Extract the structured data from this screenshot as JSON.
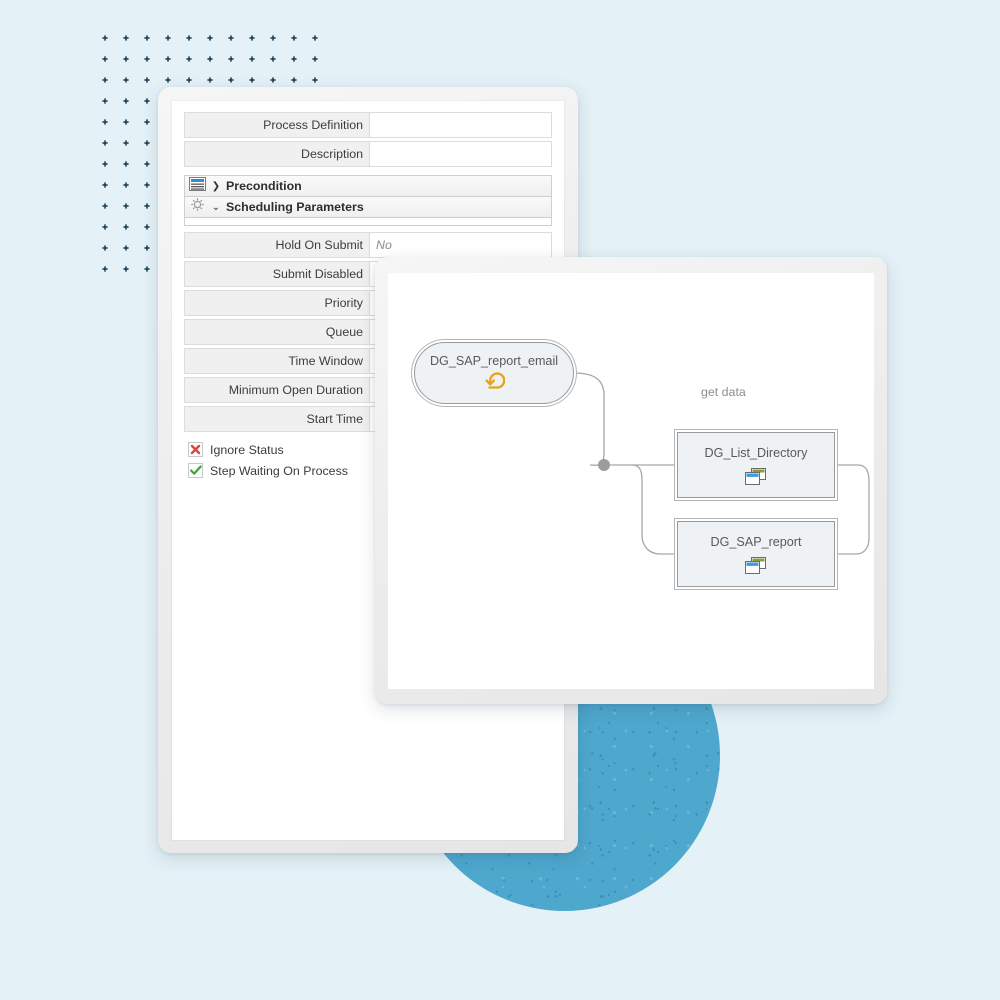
{
  "theme": {
    "background": "#e4f1f7",
    "accent_circle": "#4ea7cd",
    "dot_color": "#143a52",
    "panel_bg": "#ececec",
    "canvas_bg": "#ffffff",
    "label_cell_bg": "#f0f0f0",
    "node_fill": "#eef2f4",
    "node_border": "#9a9a9a",
    "wire_color": "#a6a6a6",
    "start_icon_color": "#e8a317",
    "check_green": "#3aa33a",
    "cross_red": "#d9453a"
  },
  "form_panel": {
    "name": "process-definition-form",
    "rows": [
      {
        "label": "Process Definition",
        "value": "",
        "placeholder": ""
      },
      {
        "label": "Description",
        "value": "",
        "placeholder": ""
      }
    ],
    "sections": [
      {
        "name": "precondition",
        "title": "Precondition",
        "expanded": false,
        "chevron": "❯",
        "icon": "form-list-icon"
      },
      {
        "name": "scheduling-parameters",
        "title": "Scheduling Parameters",
        "expanded": true,
        "chevron": "⌄",
        "icon": "gear-icon"
      }
    ],
    "scheduling_rows": [
      {
        "label": "Hold On Submit",
        "value": "No",
        "is_placeholder": true
      },
      {
        "label": "Submit Disabled",
        "value": "",
        "is_placeholder": false
      },
      {
        "label": "Priority",
        "value": "",
        "is_placeholder": false
      },
      {
        "label": "Queue",
        "value": "",
        "is_placeholder": false
      },
      {
        "label": "Time Window",
        "value": "",
        "is_placeholder": false
      },
      {
        "label": "Minimum Open Duration",
        "value": "",
        "is_placeholder": false
      },
      {
        "label": "Start Time",
        "value": "",
        "is_placeholder": false
      }
    ],
    "checkboxes": [
      {
        "label": "Ignore Status",
        "state": "unchecked",
        "glyph": "✖",
        "icon": "red-cross-icon"
      },
      {
        "label": "Step Waiting On Process",
        "state": "checked",
        "glyph": "✔",
        "icon": "green-check-icon"
      }
    ]
  },
  "diagram_panel": {
    "name": "process-flow-diagram",
    "nodes": [
      {
        "id": "start",
        "label": "DG_SAP_report_email",
        "shape": "stadium",
        "icon": "recurrence-loop-icon"
      },
      {
        "id": "list_dir",
        "label": "DG_List_Directory",
        "shape": "rectangle",
        "icon": "cascade-windows-icon"
      },
      {
        "id": "sap_report",
        "label": "DG_SAP_report",
        "shape": "rectangle",
        "icon": "cascade-windows-icon"
      }
    ],
    "edge_labels": [
      {
        "id": "get_data",
        "text": "get data"
      }
    ],
    "junction": {
      "id": "branch-dot",
      "shape": "dot"
    }
  }
}
